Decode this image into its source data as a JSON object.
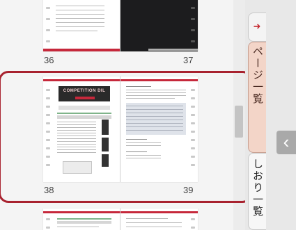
{
  "thumbnails": {
    "top_spread": {
      "left_page": "36",
      "right_page": "37"
    },
    "middle_spread": {
      "left_page": "38",
      "right_page": "39",
      "left_title": "COMPETITION DIL",
      "highlighted": true
    },
    "bottom_spread": {}
  },
  "side_tabs": {
    "arrow_glyph": "➜",
    "page_list_tab": "ページ一覧",
    "bookmark_tab": "しおり一覧"
  },
  "collapse_glyph": "‹",
  "colors": {
    "highlight": "#a8222f",
    "accent_red": "#c6283b",
    "tab_active": "#f3d5c8"
  },
  "icons": [
    "arrow-right-icon",
    "collapse-chevron-icon"
  ]
}
